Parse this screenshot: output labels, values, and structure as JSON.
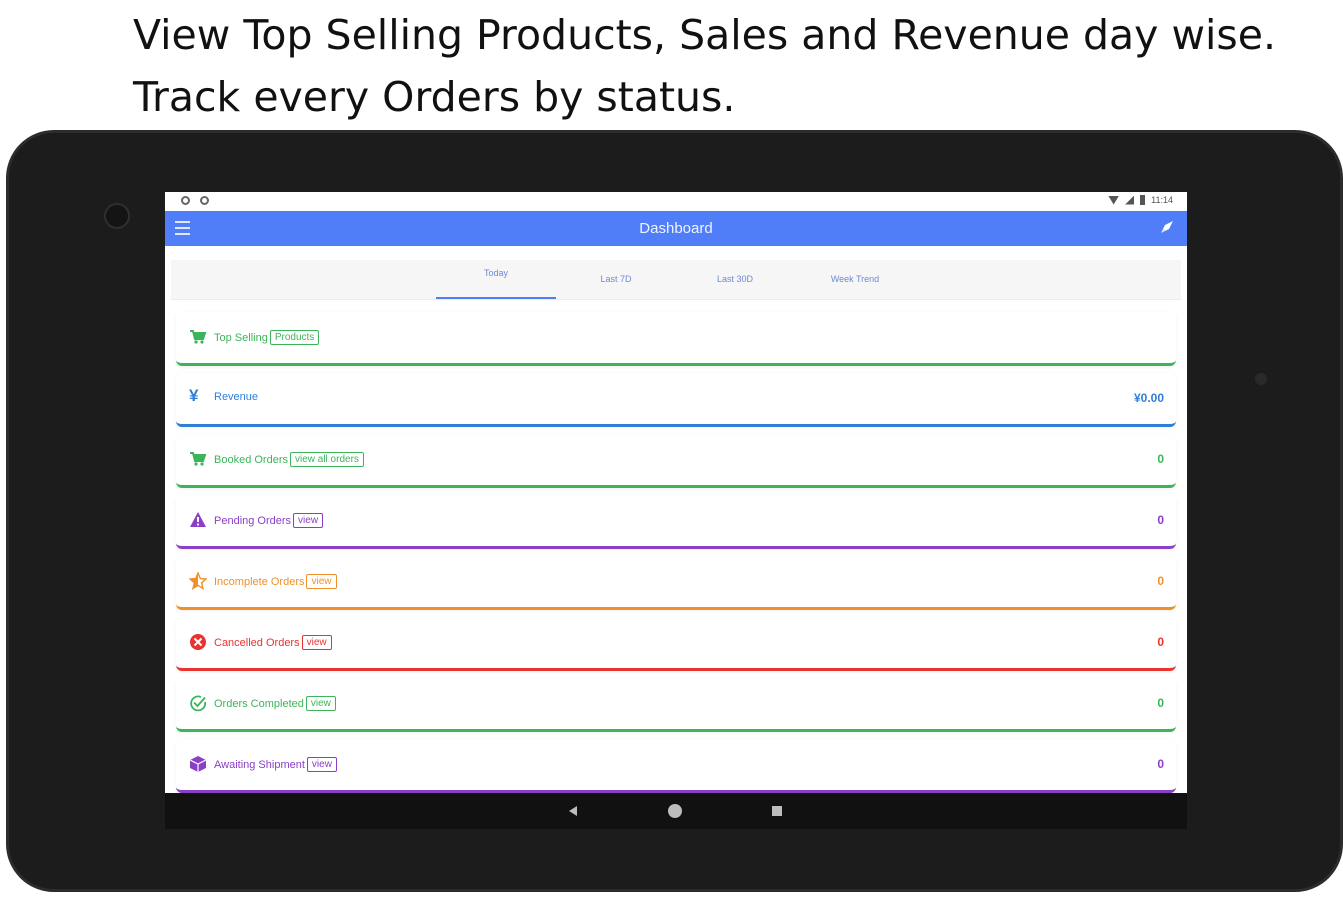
{
  "headline": {
    "line1": "View Top Selling Products, Sales and Revenue day wise.",
    "line2": "Track every Orders by status."
  },
  "status_bar": {
    "time": "11:14"
  },
  "app_bar": {
    "title": "Dashboard",
    "menu_icon": "hamburger-icon",
    "action_icon": "rocket-icon",
    "color": "#4f7ef8"
  },
  "tabs": [
    {
      "label": "Today",
      "active": true
    },
    {
      "label": "Last 7D",
      "active": false
    },
    {
      "label": "Last 30D",
      "active": false
    },
    {
      "label": "Week Trend",
      "active": false
    }
  ],
  "cards": [
    {
      "label": "Top Selling",
      "action": "Products",
      "value": "",
      "color": "#3cb55a",
      "icon": "cart-icon"
    },
    {
      "label": "Revenue",
      "action": "",
      "value": "¥0.00",
      "color": "#2f7fd9",
      "icon": "yen-icon"
    },
    {
      "label": "Booked Orders",
      "action": "view all orders",
      "value": "0",
      "color": "#3cb55a",
      "icon": "cart-icon"
    },
    {
      "label": "Pending Orders",
      "action": "view",
      "value": "0",
      "color": "#8a3fc6",
      "icon": "warning-icon"
    },
    {
      "label": "Incomplete Orders",
      "action": "view",
      "value": "0",
      "color": "#f0902a",
      "icon": "half-star-icon"
    },
    {
      "label": "Cancelled Orders",
      "action": "view",
      "value": "0",
      "color": "#e8332f",
      "icon": "cancel-icon"
    },
    {
      "label": "Orders Completed",
      "action": "view",
      "value": "0",
      "color": "#3cb55a",
      "icon": "check-circle-icon"
    },
    {
      "label": "Awaiting Shipment",
      "action": "view",
      "value": "0",
      "color": "#8a3fc6",
      "icon": "box-icon"
    }
  ]
}
